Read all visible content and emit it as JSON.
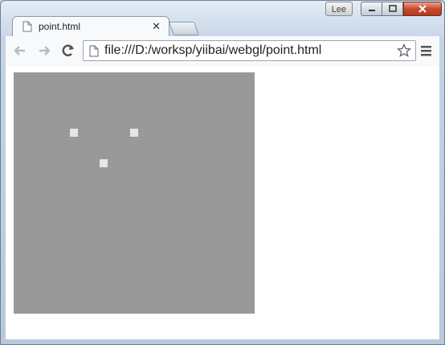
{
  "window": {
    "user_badge": "Lee"
  },
  "tab": {
    "title": "point.html"
  },
  "address_bar": {
    "url": "file:///D:/worksp/yiibai/webgl/point.html"
  },
  "canvas": {
    "background": "#999999",
    "point_color": "#e6e6e6",
    "point_count": 3
  }
}
